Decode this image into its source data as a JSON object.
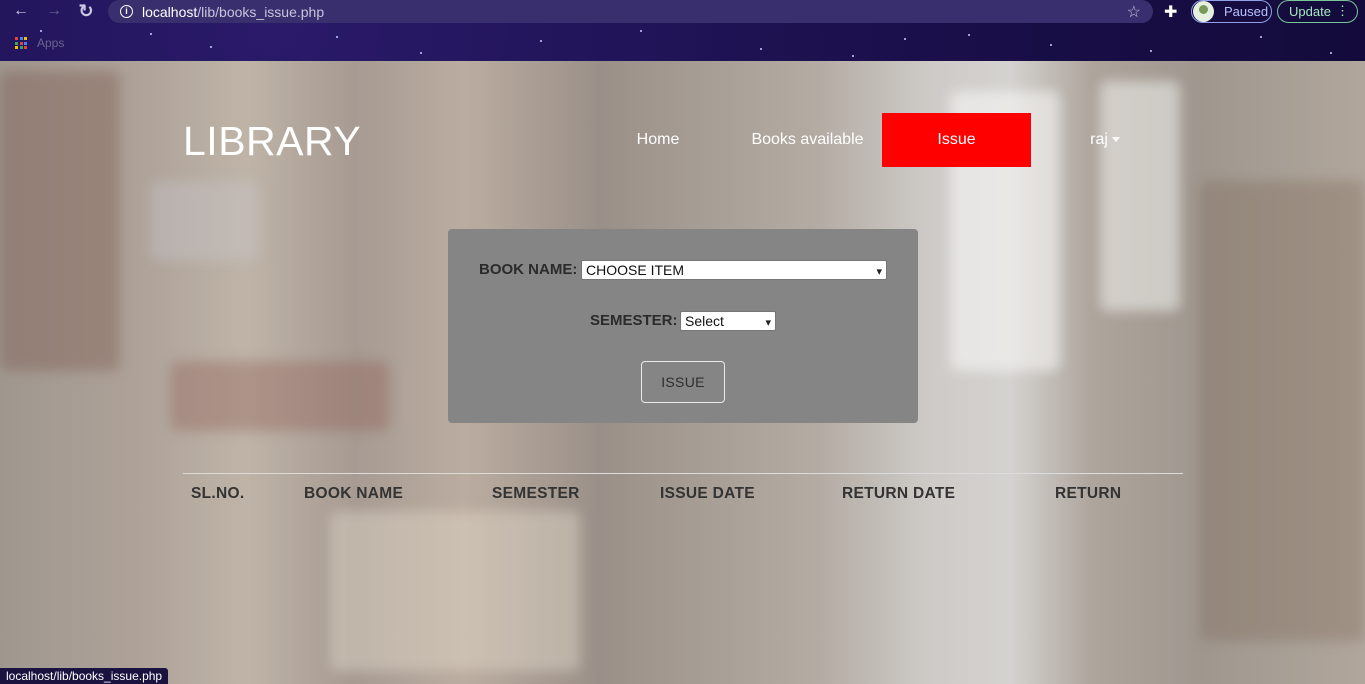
{
  "browser": {
    "url_host": "localhost",
    "url_path": "/lib/books_issue.php",
    "profile_status": "Paused",
    "update_label": "Update",
    "bookmarks_apps": "Apps",
    "status_url": "localhost/lib/books_issue.php",
    "icons": [
      "back-arrow-icon",
      "forward-arrow-icon",
      "reload-icon",
      "info-icon",
      "star-icon",
      "puzzle-icon",
      "kebab-icon",
      "apps-grid-icon"
    ]
  },
  "header": {
    "logo": "LIBRARY",
    "nav": [
      {
        "label": "Home",
        "active": false
      },
      {
        "label": "Books available",
        "active": false
      },
      {
        "label": "Issue",
        "active": true
      },
      {
        "label": "raj",
        "active": false,
        "dropdown": true
      }
    ],
    "active_color": "#ff0000"
  },
  "form": {
    "book_label": "BOOK NAME:",
    "book_value": "CHOOSE ITEM",
    "semester_label": "SEMESTER:",
    "semester_value": "Select",
    "submit_label": "ISSUE"
  },
  "table": {
    "columns": [
      "SL.NO.",
      "BOOK NAME",
      "SEMESTER",
      "ISSUE DATE",
      "RETURN DATE",
      "RETURN"
    ],
    "rows": []
  }
}
